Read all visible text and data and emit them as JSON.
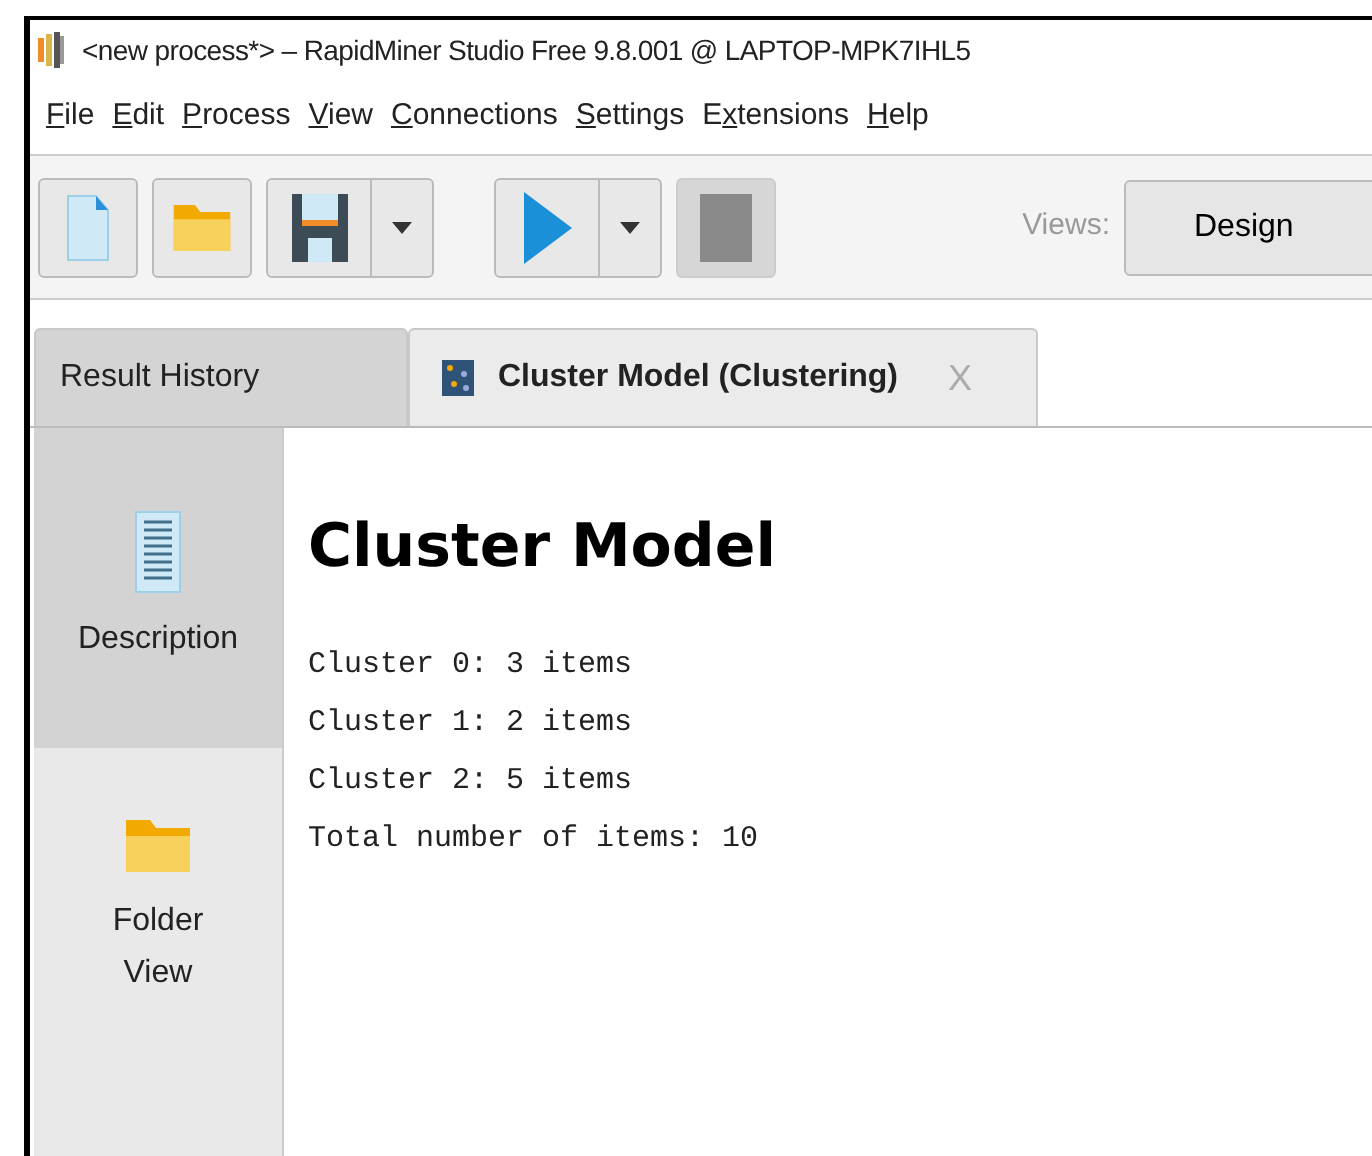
{
  "window": {
    "title": "<new process*> – RapidMiner Studio Free 9.8.001 @ LAPTOP-MPK7IHL5"
  },
  "menu": [
    {
      "mnemonic": "F",
      "after": "ile"
    },
    {
      "mnemonic": "E",
      "after": "dit"
    },
    {
      "mnemonic": "P",
      "after": "rocess"
    },
    {
      "mnemonic": "V",
      "after": "iew"
    },
    {
      "mnemonic": "C",
      "after": "onnections"
    },
    {
      "mnemonic": "S",
      "after": "ettings"
    },
    {
      "before": "E",
      "mnemonic": "x",
      "after": "tensions"
    },
    {
      "mnemonic": "H",
      "after": "elp"
    }
  ],
  "toolbar": {
    "views_label": "Views:",
    "views": [
      {
        "label": "Design",
        "selected": false
      }
    ]
  },
  "tabs": [
    {
      "label": "Result History",
      "selected": false
    },
    {
      "label": "Cluster Model (Clustering)",
      "selected": true,
      "close": "X"
    }
  ],
  "sidebar": {
    "items": [
      {
        "label": "Description",
        "kind": "document",
        "selected": true
      },
      {
        "label": "Folder\nView",
        "kind": "folder",
        "selected": false
      }
    ]
  },
  "content": {
    "heading": "Cluster Model",
    "lines": [
      "Cluster 0: 3 items",
      "Cluster 1: 2 items",
      "Cluster 2: 5 items",
      "Total number of items: 10"
    ]
  }
}
